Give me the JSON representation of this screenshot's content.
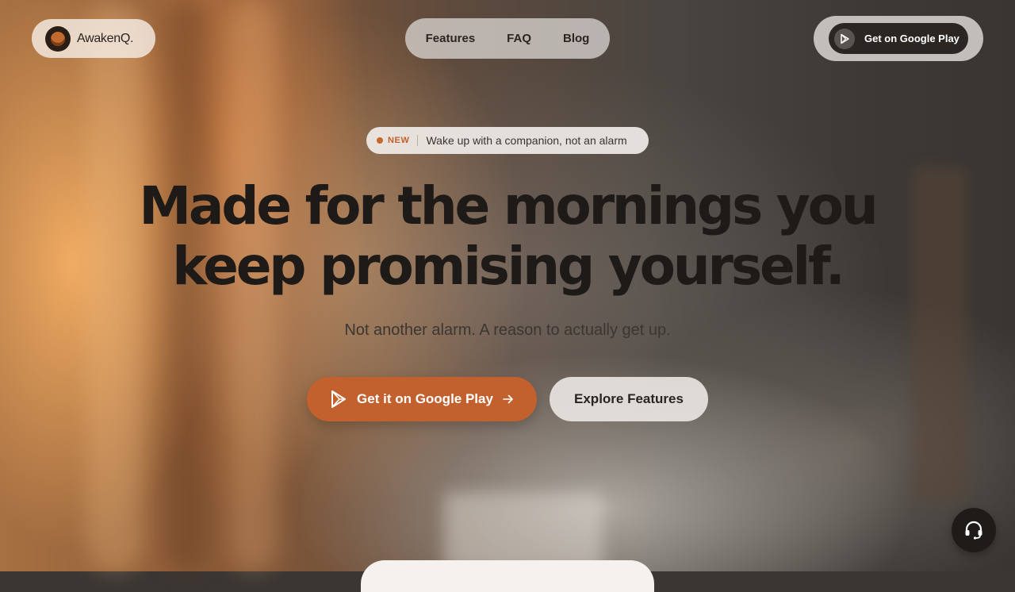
{
  "brand": {
    "name": "AwakenQ."
  },
  "nav": {
    "items": [
      "Features",
      "FAQ",
      "Blog"
    ]
  },
  "header_cta": {
    "label": "Get on Google Play"
  },
  "badge": {
    "tag": "NEW",
    "text": "Wake up with a companion, not an alarm"
  },
  "hero": {
    "headline_line1": "Made for the mornings you",
    "headline_line2": "keep promising yourself.",
    "subheadline": "Not another alarm. A reason to actually get up."
  },
  "buttons": {
    "primary_label": "Get it on Google Play",
    "secondary_label": "Explore Features"
  },
  "colors": {
    "accent": "#c2612d",
    "dark": "#2c2623",
    "headline": "#1d1a18"
  },
  "icons": {
    "play_store": "google-play-icon",
    "arrow": "arrow-right-icon",
    "support": "headset-icon"
  }
}
